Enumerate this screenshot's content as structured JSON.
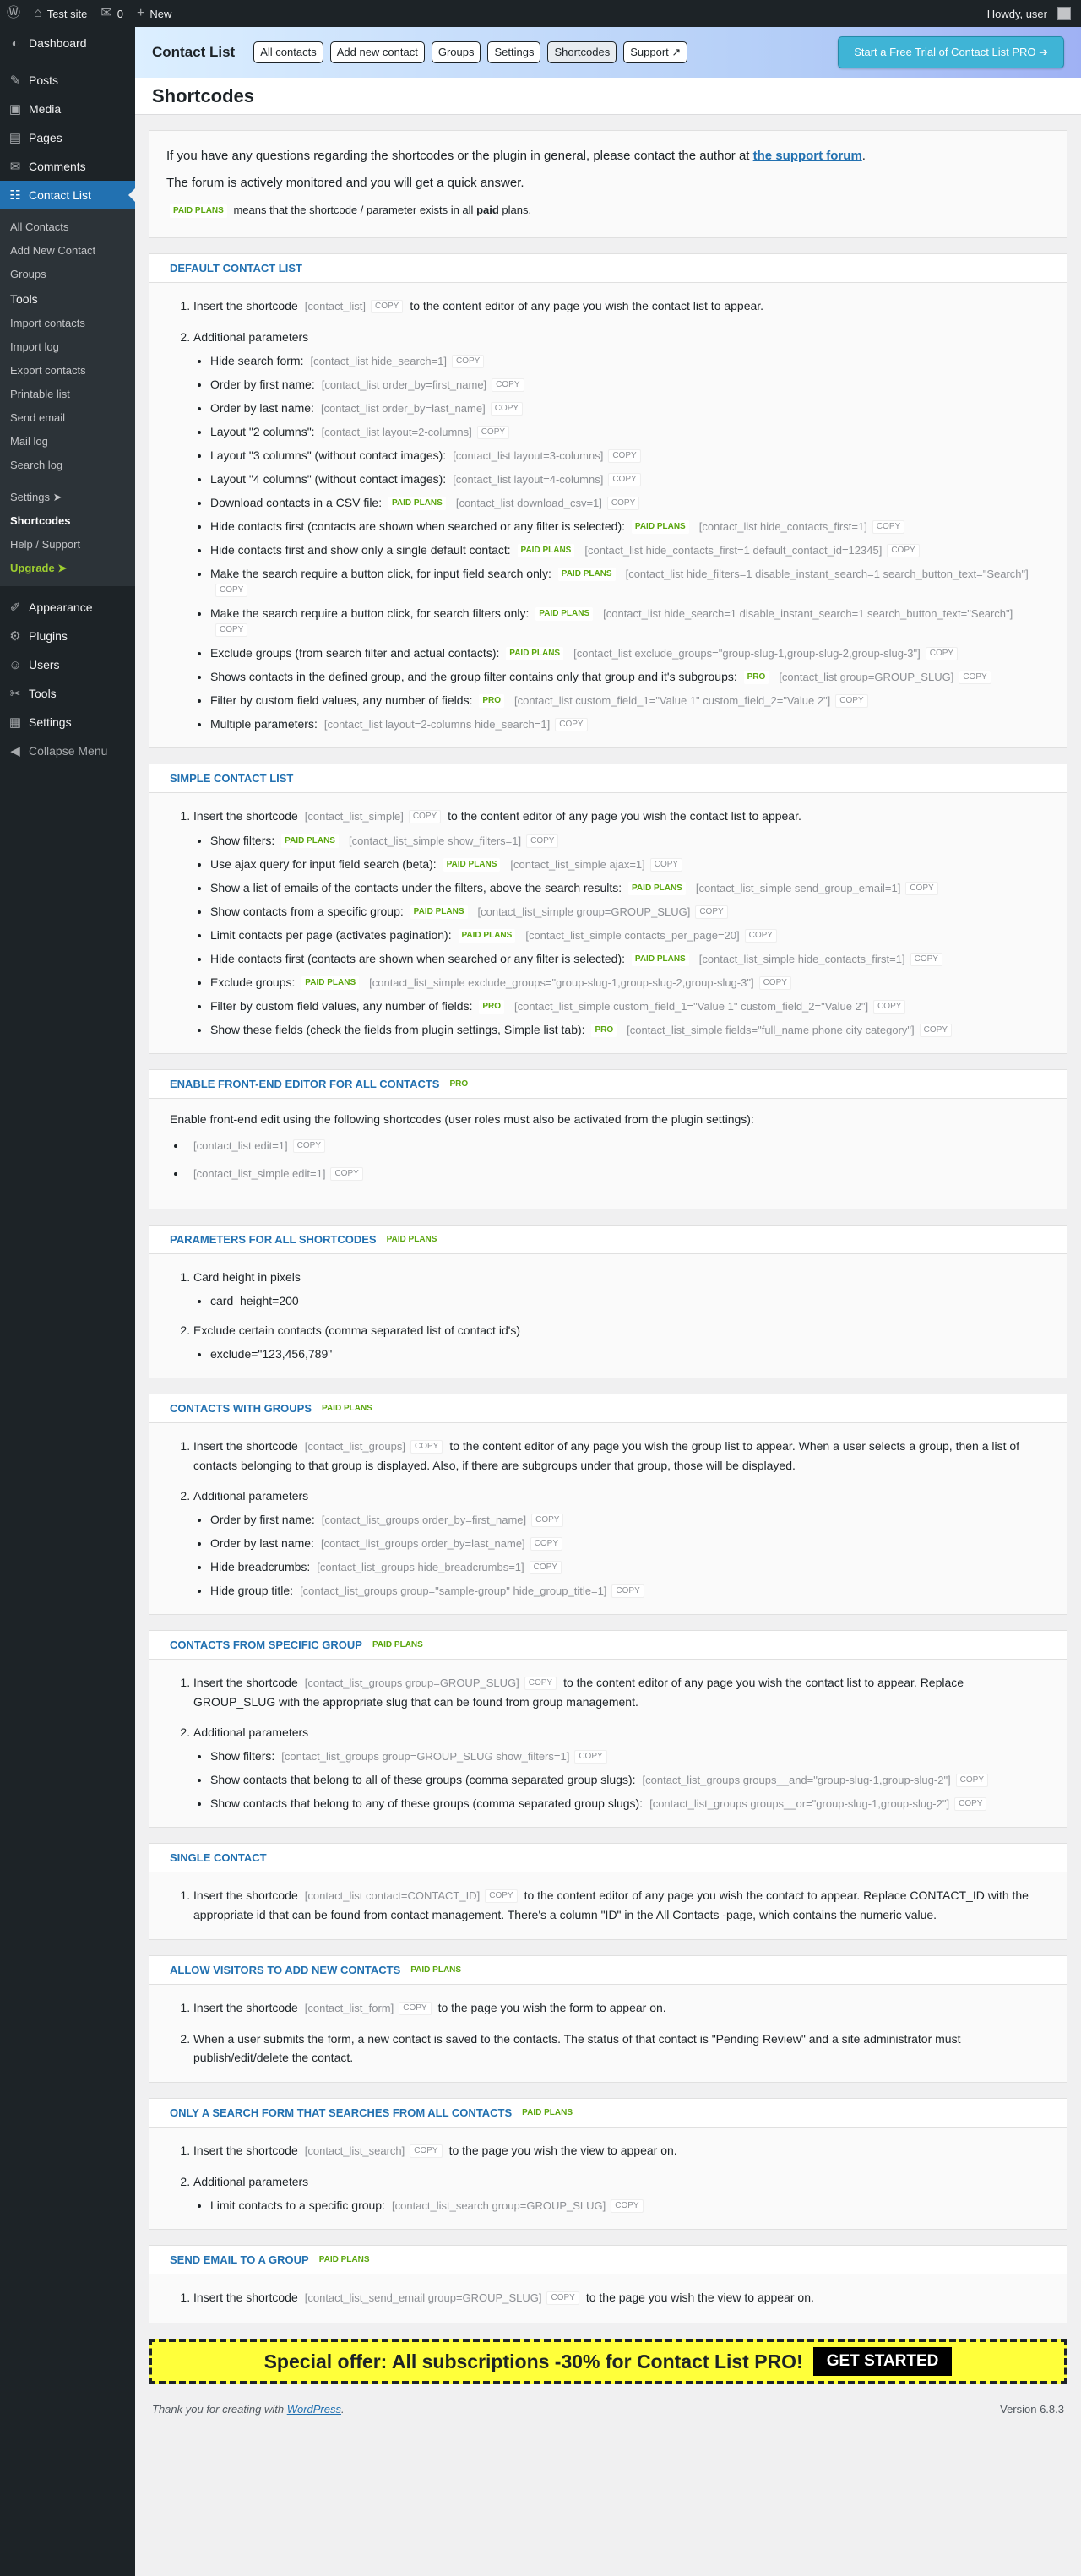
{
  "adminbar": {
    "site": "Test site",
    "comments": "0",
    "new": "New",
    "howdy": "Howdy, user"
  },
  "sidebar": {
    "items": [
      {
        "label": "Dashboard",
        "icon": "dashboard-icon",
        "glyph": "◐"
      },
      {
        "label": "Posts",
        "icon": "pin-icon",
        "glyph": "✎"
      },
      {
        "label": "Media",
        "icon": "media-icon",
        "glyph": "▣"
      },
      {
        "label": "Pages",
        "icon": "pages-icon",
        "glyph": "▤"
      },
      {
        "label": "Comments",
        "icon": "comment-icon",
        "glyph": "✉"
      },
      {
        "label": "Contact List",
        "icon": "contacts-icon",
        "glyph": "☷"
      }
    ],
    "sub": [
      "All Contacts",
      "Add New Contact",
      "Groups",
      "Tools",
      "Import contacts",
      "Import log",
      "Export contacts",
      "Printable list",
      "Send email",
      "Mail log",
      "Search log",
      "Settings ➤",
      "Shortcodes",
      "Help / Support",
      "Upgrade ➤"
    ],
    "bottom": [
      {
        "label": "Appearance",
        "glyph": "✐",
        "icon": "appearance-icon"
      },
      {
        "label": "Plugins",
        "glyph": "⚙",
        "icon": "plugins-icon"
      },
      {
        "label": "Users",
        "glyph": "☺",
        "icon": "users-icon"
      },
      {
        "label": "Tools",
        "glyph": "✂",
        "icon": "tools-icon"
      },
      {
        "label": "Settings",
        "glyph": "▦",
        "icon": "settings-icon"
      },
      {
        "label": "Collapse Menu",
        "glyph": "◀",
        "icon": "collapse-icon"
      }
    ]
  },
  "topbar": {
    "brand": "Contact List",
    "buttons": [
      "All contacts",
      "Add new contact",
      "Groups",
      "Settings",
      "Shortcodes",
      "Support ↗"
    ],
    "trial": "Start a Free Trial of Contact List PRO ➔"
  },
  "title": "Shortcodes",
  "intro": {
    "p1": "If you have any questions regarding the shortcodes or the plugin in general, please contact the author at",
    "link": "the support forum",
    "p1end": ".",
    "p2": "The forum is actively monitored and you will get a quick answer.",
    "badge": "PAID PLANS",
    "p3a": "means that the shortcode / parameter exists in all",
    "p3b": "paid",
    "p3c": "plans."
  },
  "copy": "COPY",
  "sections": [
    {
      "title": "DEFAULT CONTACT LIST",
      "badge": "",
      "items": [
        {
          "text": "Insert the shortcode",
          "code": "[contact_list]",
          "after": "to the content editor of any page you wish the contact list to appear.",
          "subs": []
        },
        {
          "text": "Additional parameters",
          "code": "",
          "after": "",
          "subs": [
            {
              "l": "Hide search form:",
              "b": "",
              "c": "[contact_list hide_search=1]"
            },
            {
              "l": "Order by first name:",
              "b": "",
              "c": "[contact_list order_by=first_name]"
            },
            {
              "l": "Order by last name:",
              "b": "",
              "c": "[contact_list order_by=last_name]"
            },
            {
              "l": "Layout \"2 columns\":",
              "b": "",
              "c": "[contact_list layout=2-columns]"
            },
            {
              "l": "Layout \"3 columns\" (without contact images):",
              "b": "",
              "c": "[contact_list layout=3-columns]"
            },
            {
              "l": "Layout \"4 columns\" (without contact images):",
              "b": "",
              "c": "[contact_list layout=4-columns]"
            },
            {
              "l": "Download contacts in a CSV file:",
              "b": "PAID PLANS",
              "c": "[contact_list download_csv=1]"
            },
            {
              "l": "Hide contacts first (contacts are shown when searched or any filter is selected):",
              "b": "PAID PLANS",
              "c": "[contact_list hide_contacts_first=1]"
            },
            {
              "l": "Hide contacts first and show only a single default contact:",
              "b": "PAID PLANS",
              "c": "[contact_list hide_contacts_first=1 default_contact_id=12345]"
            },
            {
              "l": "Make the search require a button click, for input field search only:",
              "b": "PAID PLANS",
              "c": "[contact_list hide_filters=1 disable_instant_search=1 search_button_text=\"Search\"]"
            },
            {
              "l": "Make the search require a button click, for search filters only:",
              "b": "PAID PLANS",
              "c": "[contact_list hide_search=1 disable_instant_search=1 search_button_text=\"Search\"]"
            },
            {
              "l": "Exclude groups (from search filter and actual contacts):",
              "b": "PAID PLANS",
              "c": "[contact_list exclude_groups=\"group-slug-1,group-slug-2,group-slug-3\"]"
            },
            {
              "l": "Shows contacts in the defined group, and the group filter contains only that group and it's subgroups:",
              "b": "PRO",
              "c": "[contact_list group=GROUP_SLUG]"
            },
            {
              "l": "Filter by custom field values, any number of fields:",
              "b": "PRO",
              "c": "[contact_list custom_field_1=\"Value 1\" custom_field_2=\"Value 2\"]"
            },
            {
              "l": "Multiple parameters:",
              "b": "",
              "c": "[contact_list layout=2-columns hide_search=1]"
            }
          ]
        }
      ]
    },
    {
      "title": "SIMPLE CONTACT LIST",
      "badge": "",
      "items": [
        {
          "text": "Insert the shortcode",
          "code": "[contact_list_simple]",
          "after": "to the content editor of any page you wish the contact list to appear.",
          "subs": [
            {
              "l": "Show filters:",
              "b": "PAID PLANS",
              "c": "[contact_list_simple show_filters=1]"
            },
            {
              "l": "Use ajax query for input field search (beta):",
              "b": "PAID PLANS",
              "c": "[contact_list_simple ajax=1]"
            },
            {
              "l": "Show a list of emails of the contacts under the filters, above the search results:",
              "b": "PAID PLANS",
              "c": "[contact_list_simple send_group_email=1]"
            },
            {
              "l": "Show contacts from a specific group:",
              "b": "PAID PLANS",
              "c": "[contact_list_simple group=GROUP_SLUG]"
            },
            {
              "l": "Limit contacts per page (activates pagination):",
              "b": "PAID PLANS",
              "c": "[contact_list_simple contacts_per_page=20]"
            },
            {
              "l": "Hide contacts first (contacts are shown when searched or any filter is selected):",
              "b": "PAID PLANS",
              "c": "[contact_list_simple hide_contacts_first=1]"
            },
            {
              "l": "Exclude groups:",
              "b": "PAID PLANS",
              "c": "[contact_list_simple exclude_groups=\"group-slug-1,group-slug-2,group-slug-3\"]"
            },
            {
              "l": "Filter by custom field values, any number of fields:",
              "b": "PRO",
              "c": "[contact_list_simple custom_field_1=\"Value 1\" custom_field_2=\"Value 2\"]"
            },
            {
              "l": "Show these fields (check the fields from plugin settings, Simple list tab):",
              "b": "PRO",
              "c": "[contact_list_simple fields=\"full_name phone city category\"]"
            }
          ]
        }
      ]
    },
    {
      "title": "ENABLE FRONT-END EDITOR FOR ALL CONTACTS",
      "badge": "PRO",
      "plain": "Enable front-end edit using the following shortcodes (user roles must also be activated from the plugin settings):",
      "bullets": [
        "[contact_list edit=1]",
        "[contact_list_simple edit=1]"
      ],
      "items": []
    },
    {
      "title": "PARAMETERS FOR ALL SHORTCODES",
      "badge": "PAID PLANS",
      "items": [
        {
          "text": "Card height in pixels",
          "code": "",
          "after": "",
          "subs": [
            {
              "l": "card_height=200",
              "b": "",
              "c": ""
            }
          ]
        },
        {
          "text": "Exclude certain contacts (comma separated list of contact id's)",
          "code": "",
          "after": "",
          "subs": [
            {
              "l": "exclude=\"123,456,789\"",
              "b": "",
              "c": ""
            }
          ]
        }
      ]
    },
    {
      "title": "CONTACTS WITH GROUPS",
      "badge": "PAID PLANS",
      "items": [
        {
          "text": "Insert the shortcode",
          "code": "[contact_list_groups]",
          "after": "to the content editor of any page you wish the group list to appear. When a user selects a group, then a list of contacts belonging to that group is displayed. Also, if there are subgroups under that group, those will be displayed.",
          "subs": []
        },
        {
          "text": "Additional parameters",
          "code": "",
          "after": "",
          "subs": [
            {
              "l": "Order by first name:",
              "b": "",
              "c": "[contact_list_groups order_by=first_name]"
            },
            {
              "l": "Order by last name:",
              "b": "",
              "c": "[contact_list_groups order_by=last_name]"
            },
            {
              "l": "Hide breadcrumbs:",
              "b": "",
              "c": "[contact_list_groups hide_breadcrumbs=1]"
            },
            {
              "l": "Hide group title:",
              "b": "",
              "c": "[contact_list_groups group=\"sample-group\" hide_group_title=1]"
            }
          ]
        }
      ]
    },
    {
      "title": "CONTACTS FROM SPECIFIC GROUP",
      "badge": "PAID PLANS",
      "items": [
        {
          "text": "Insert the shortcode",
          "code": "[contact_list_groups group=GROUP_SLUG]",
          "after": "to the content editor of any page you wish the contact list to appear. Replace GROUP_SLUG with the appropriate slug that can be found from group management.",
          "subs": []
        },
        {
          "text": "Additional parameters",
          "code": "",
          "after": "",
          "subs": [
            {
              "l": "Show filters:",
              "b": "",
              "c": "[contact_list_groups group=GROUP_SLUG show_filters=1]"
            },
            {
              "l": "Show contacts that belong to all of these groups (comma separated group slugs):",
              "b": "",
              "c": "[contact_list_groups groups__and=\"group-slug-1,group-slug-2\"]"
            },
            {
              "l": "Show contacts that belong to any of these groups (comma separated group slugs):",
              "b": "",
              "c": "[contact_list_groups groups__or=\"group-slug-1,group-slug-2\"]"
            }
          ]
        }
      ]
    },
    {
      "title": "SINGLE CONTACT",
      "badge": "",
      "items": [
        {
          "text": "Insert the shortcode",
          "code": "[contact_list contact=CONTACT_ID]",
          "after": "to the content editor of any page you wish the contact to appear. Replace CONTACT_ID with the appropriate id that can be found from contact management. There's a column \"ID\" in the All Contacts -page, which contains the numeric value.",
          "subs": []
        }
      ]
    },
    {
      "title": "ALLOW VISITORS TO ADD NEW CONTACTS",
      "badge": "PAID PLANS",
      "items": [
        {
          "text": "Insert the shortcode",
          "code": "[contact_list_form]",
          "after": "to the page you wish the form to appear on.",
          "subs": []
        },
        {
          "text": "When a user submits the form, a new contact is saved to the contacts. The status of that contact is \"Pending Review\" and a site administrator must publish/edit/delete the contact.",
          "code": "",
          "after": "",
          "subs": []
        }
      ]
    },
    {
      "title": "ONLY A SEARCH FORM THAT SEARCHES FROM ALL CONTACTS",
      "badge": "PAID PLANS",
      "items": [
        {
          "text": "Insert the shortcode",
          "code": "[contact_list_search]",
          "after": "to the page you wish the view to appear on.",
          "subs": []
        },
        {
          "text": "Additional parameters",
          "code": "",
          "after": "",
          "subs": [
            {
              "l": "Limit contacts to a specific group:",
              "b": "",
              "c": "[contact_list_search group=GROUP_SLUG]"
            }
          ]
        }
      ]
    },
    {
      "title": "SEND EMAIL TO A GROUP",
      "badge": "PAID PLANS",
      "items": [
        {
          "text": "Insert the shortcode",
          "code": "[contact_list_send_email group=GROUP_SLUG]",
          "after": "to the page you wish the view to appear on.",
          "subs": []
        }
      ]
    }
  ],
  "offer": {
    "text": "Special offer: All subscriptions -30% for Contact List PRO!",
    "button": "GET STARTED"
  },
  "footer": {
    "thanks": "Thank you for creating with",
    "wp": "WordPress",
    "end": ".",
    "version": "Version 6.8.3"
  }
}
